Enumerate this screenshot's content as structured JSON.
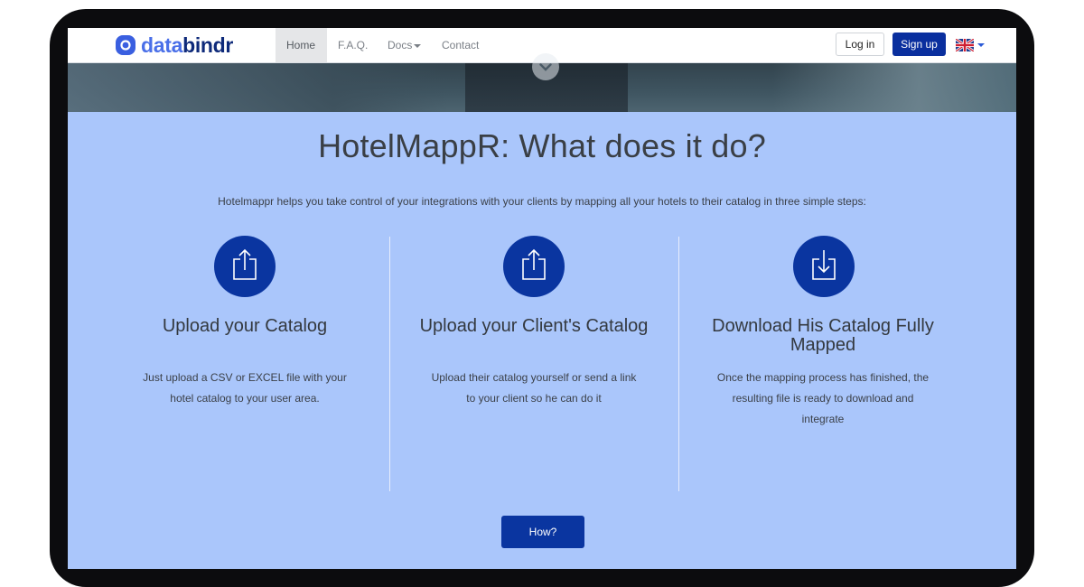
{
  "nav": {
    "logo": {
      "text_part1": "data",
      "text_part2": "bindr",
      "icon": "databindr-logo-icon"
    },
    "links": [
      {
        "label": "Home",
        "active": true
      },
      {
        "label": "F.A.Q.",
        "active": false
      },
      {
        "label": "Docs",
        "active": false,
        "dropdown": true
      },
      {
        "label": "Contact",
        "active": false
      }
    ],
    "login_label": "Log in",
    "signup_label": "Sign up",
    "language": {
      "icon": "uk-flag-icon",
      "dropdown": true
    }
  },
  "hero": {
    "scroll_icon": "chevron-down-icon"
  },
  "main": {
    "title": "HotelMappR: What does it do?",
    "intro": "Hotelmappr helps you take control of your integrations with your clients by mapping all your hotels to their catalog in three simple steps:",
    "steps": [
      {
        "icon": "upload-icon",
        "title": "Upload your Catalog",
        "description": "Just upload a CSV or EXCEL file with your hotel catalog to your user area."
      },
      {
        "icon": "upload-icon",
        "title": "Upload your Client's Catalog",
        "description": "Upload their catalog yourself or send a link to your client so he can do it"
      },
      {
        "icon": "download-icon",
        "title": "Download His Catalog Fully Mapped",
        "description": "Once the mapping process has finished, the resulting file is ready to download and integrate"
      }
    ],
    "cta_label": "How?"
  },
  "colors": {
    "background": "#aac6fb",
    "primary": "#0a35a0",
    "frame": "#0c0c0e"
  }
}
